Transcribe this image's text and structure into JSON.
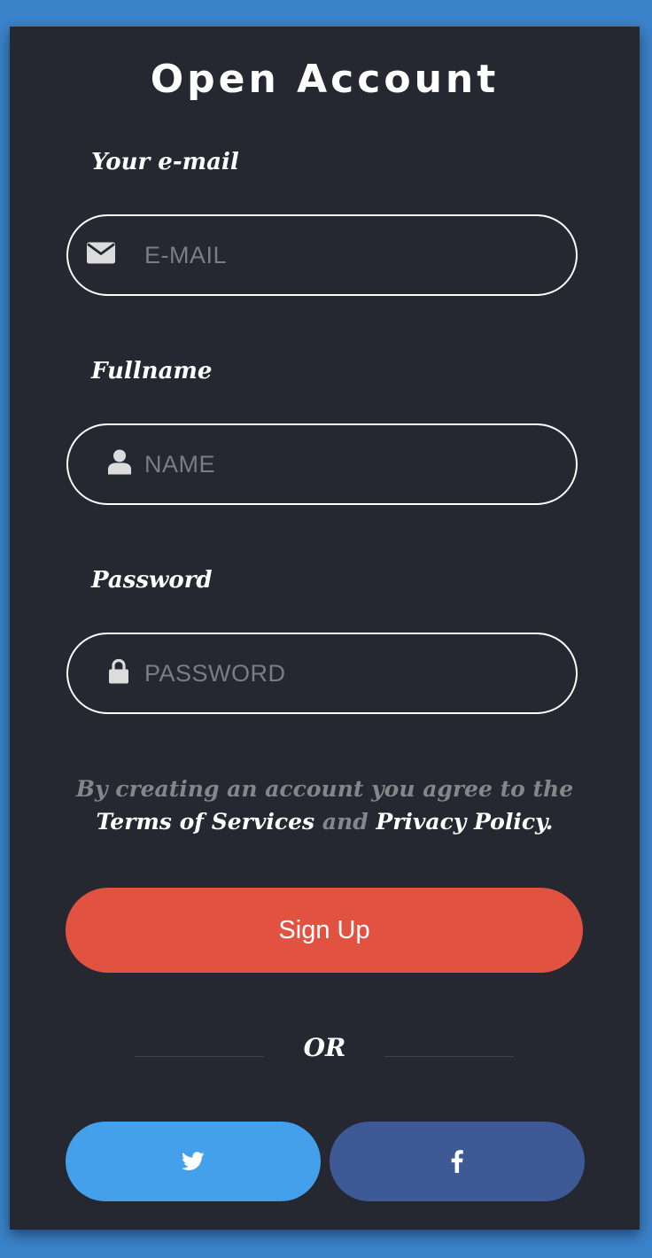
{
  "title": "Open Account",
  "form": {
    "email": {
      "label": "Your e-mail",
      "placeholder": "E-MAIL",
      "value": "",
      "icon": "envelope-icon"
    },
    "fullname": {
      "label": "Fullname",
      "placeholder": "NAME",
      "value": "",
      "icon": "user-icon"
    },
    "password": {
      "label": "Password",
      "placeholder": "PASSWORD",
      "value": "",
      "icon": "lock-icon"
    }
  },
  "terms": {
    "prefix": "By creating an account you agree to the",
    "terms_link": "Terms of Services",
    "conjunction": "and",
    "privacy_link": "Privacy Policy",
    "suffix": "."
  },
  "signup_label": "Sign Up",
  "or_label": "OR",
  "social": {
    "twitter_icon": "twitter-icon",
    "facebook_icon": "facebook-icon"
  },
  "colors": {
    "page_background": "#3a82c9",
    "card_background": "#252731",
    "signup_button": "#e15240",
    "twitter_button": "#45a0ec",
    "facebook_button": "#3e5a96",
    "placeholder_text": "#7b7d83",
    "muted_text": "#85868a"
  }
}
